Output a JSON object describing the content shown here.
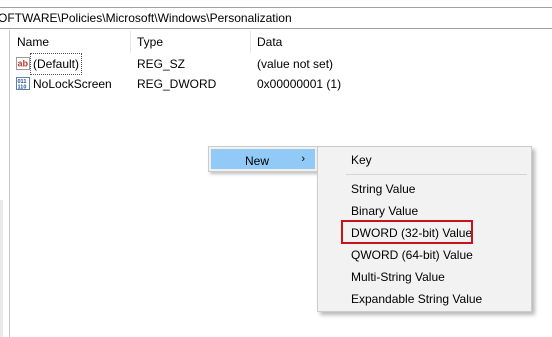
{
  "address": {
    "path": "OFTWARE\\Policies\\Microsoft\\Windows\\Personalization"
  },
  "columns": {
    "name": "Name",
    "type": "Type",
    "data": "Data"
  },
  "rows": [
    {
      "icon": "string-value-icon",
      "name": "(Default)",
      "type": "REG_SZ",
      "data": "(value not set)"
    },
    {
      "icon": "binary-value-icon",
      "name": "NoLockScreen",
      "type": "REG_DWORD",
      "data": "0x00000001 (1)"
    }
  ],
  "context_menu": {
    "parent_item": "New",
    "parent_arrow": "›",
    "submenu": {
      "key": "Key",
      "items": [
        "String Value",
        "Binary Value",
        "DWORD (32-bit) Value",
        "QWORD (64-bit) Value",
        "Multi-String Value",
        "Expandable String Value"
      ]
    }
  },
  "colors": {
    "highlight": "#91c9f7",
    "menu_bg": "#f2f2f2",
    "annotation_red": "#c8131b"
  }
}
